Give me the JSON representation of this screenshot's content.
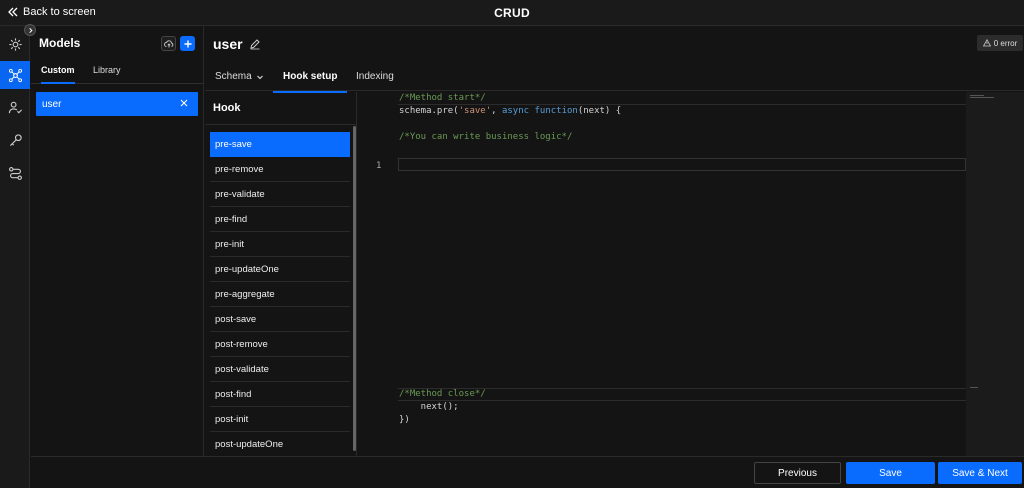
{
  "topbar": {
    "back_label": "Back to screen",
    "title": "CRUD"
  },
  "rail": {
    "items": [
      {
        "icon": "settings-gear-icon",
        "active": false
      },
      {
        "icon": "model-network-icon",
        "active": true
      },
      {
        "icon": "user-check-icon",
        "active": false
      },
      {
        "icon": "key-icon",
        "active": false
      },
      {
        "icon": "flow-route-icon",
        "active": false
      }
    ]
  },
  "models": {
    "title": "Models",
    "tabs": [
      "Custom",
      "Library"
    ],
    "active_tab": "Custom",
    "items": [
      {
        "label": "user",
        "selected": true
      }
    ]
  },
  "main": {
    "title": "user",
    "error_badge": "0 error",
    "tabs": [
      {
        "label": "Schema",
        "has_dropdown": true,
        "active": false
      },
      {
        "label": "Hook setup",
        "has_dropdown": false,
        "active": true
      },
      {
        "label": "Indexing",
        "has_dropdown": false,
        "active": false
      }
    ]
  },
  "hooks": {
    "header": "Hook",
    "items": [
      "pre-save",
      "pre-remove",
      "pre-validate",
      "pre-find",
      "pre-init",
      "pre-updateOne",
      "pre-aggregate",
      "post-save",
      "post-remove",
      "post-validate",
      "post-find",
      "post-init",
      "post-updateOne"
    ],
    "active": "pre-save"
  },
  "editor": {
    "method_start_comment": "/*Method start*/",
    "schema_prefix": "schema.pre(",
    "schema_string": "'save'",
    "schema_sep": ", ",
    "schema_kw_async": "async",
    "schema_kw_function": "function",
    "schema_suffix": "(next) {",
    "business_comment": "/*You can write business logic*/",
    "line_number": "1",
    "method_close_comment": "/*Method close*/",
    "next_call": "    next();",
    "closing": "})"
  },
  "footer": {
    "previous_label": "Previous",
    "save_label": "Save",
    "save_next_label": "Save & Next"
  },
  "colors": {
    "accent": "#0a6cff",
    "background": "#141414",
    "comment": "#6a9955",
    "string": "#ce9178",
    "keyword": "#569cd6"
  }
}
